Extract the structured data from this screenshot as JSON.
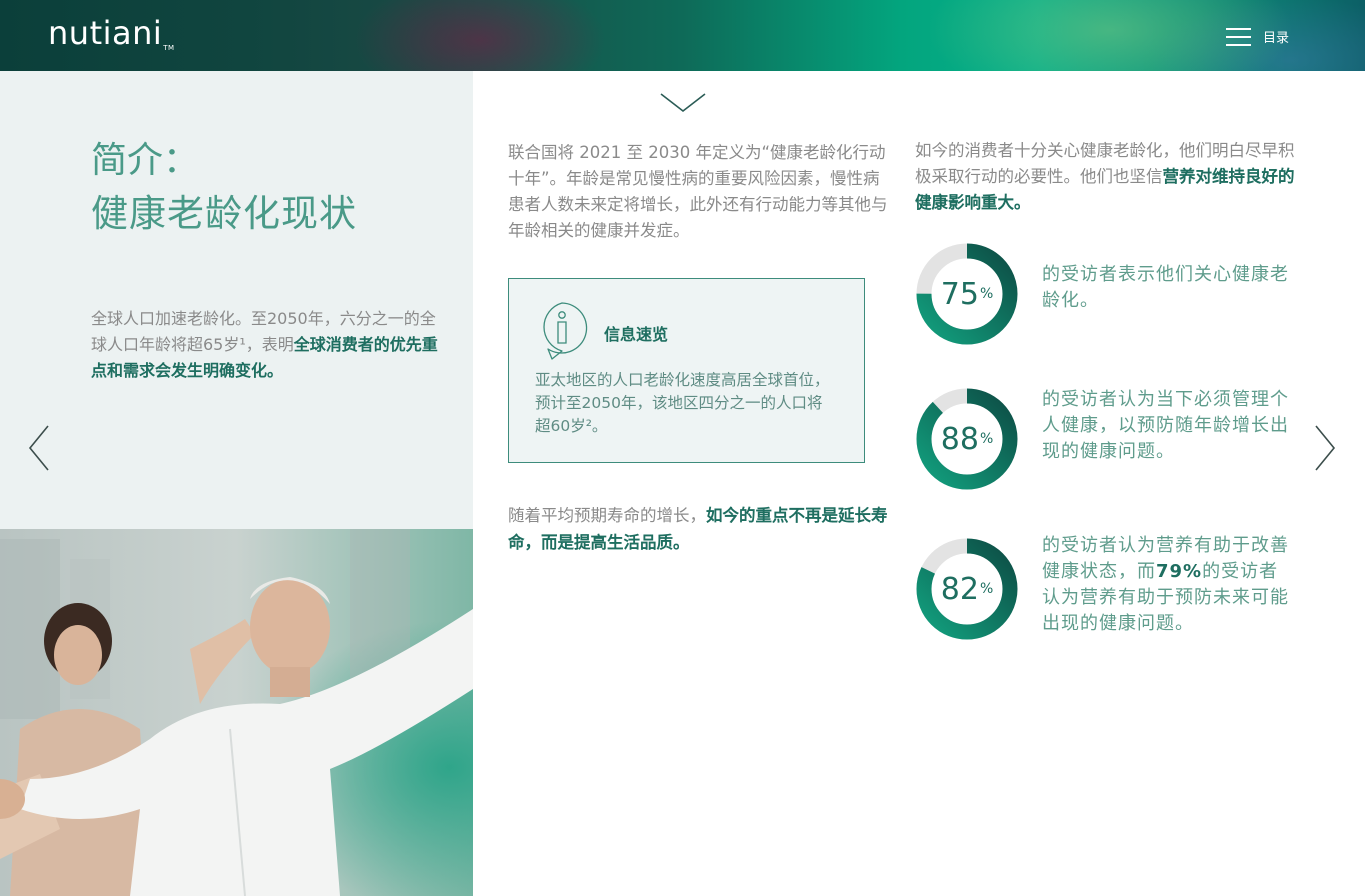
{
  "header": {
    "logo": "nutiani",
    "logo_tm": "TM",
    "menu_label": "目录"
  },
  "left": {
    "title_line1": "简介：",
    "title_line2": "健康老龄化现状",
    "intro_part1": "全球人口加速老龄化。至2050年，六分之一的全球人口年龄将超65岁¹，表明",
    "intro_bold": "全球消费者的优先重点和需求会发生明确变化。"
  },
  "middle": {
    "para1": "联合国将 2021 至 2030 年定义为“健康老龄化行动十年”。年龄是常见慢性病的重要风险因素，慢性病患者人数未来定将增长，此外还有行动能力等其他与年龄相关的健康并发症。",
    "info_box": {
      "icon": "info-speech-bubble-icon",
      "title": "信息速览",
      "text": "亚太地区的人口老龄化速度高居全球首位，预计至2050年，该地区四分之一的人口将超60岁²。"
    },
    "para2_part1": "随着平均预期寿命的增长，",
    "para2_bold": "如今的重点不再是延长寿命，而是提高生活品质。"
  },
  "right": {
    "para_part1": "如今的消费者十分关心健康老龄化，他们明白尽早积极采取行动的必要性。他们也坚信",
    "para_bold": "营养对维持良好的健康影响重大。",
    "stats": [
      {
        "value": 75,
        "label": "75",
        "unit": "%",
        "text": "的受访者表示他们关心健康老龄化。"
      },
      {
        "value": 88,
        "label": "88",
        "unit": "%",
        "text": "的受访者认为当下必须管理个人健康，以预防随年龄增长出现的健康问题。"
      },
      {
        "value": 82,
        "label": "82",
        "unit": "%",
        "text_part1": "的受访者认为营养有助于改善健康状态，而",
        "text_bold": "79%",
        "text_part2": "的受访者认为营养有助于预防未来可能出现的健康问题。"
      }
    ]
  },
  "colors": {
    "teal_dark": "#1e6e60",
    "teal_light": "#4a9a88",
    "donut_track": "#e3e3e3",
    "panel_bg": "#ecf2f2"
  }
}
